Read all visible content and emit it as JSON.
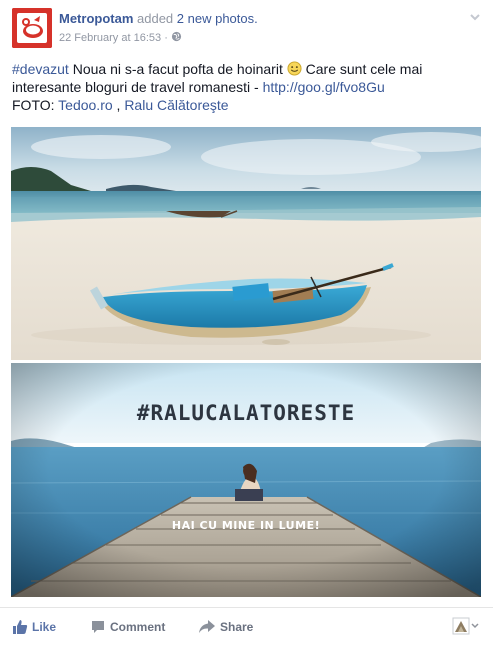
{
  "post": {
    "author": "Metropotam",
    "added_text": "added",
    "photos_link": "2 new photos.",
    "date": "22 February at 16:53",
    "meta_separator": "·",
    "hashtag": "#devazut",
    "text_main": " Noua ni s-a facut pofta de hoinarit ",
    "emoji": "smile-emoji",
    "text_cont": " Care sunt cele mai interesante bloguri de travel romanesti - ",
    "url": "http://goo.gl/fvo8Gu",
    "foto_label": "FOTO: ",
    "credit1": "Tedoo.ro",
    "credit_sep": " , ",
    "credit2": "Ralu Călătoreşte"
  },
  "photos": {
    "photo2_title": "#RALUCALATORESTE",
    "photo2_subtitle": "HAI CU MINE IN LUME!"
  },
  "actions": {
    "like": "Like",
    "comment": "Comment",
    "share": "Share"
  },
  "colors": {
    "brand_link": "#3b5998",
    "avatar_bg": "#d6322a"
  },
  "icons": {
    "avatar": "metropotam-logo",
    "globe": "globe-icon",
    "chevron": "chevron-down-icon",
    "like": "thumbs-up-icon",
    "comment": "comment-bubble-icon",
    "share": "share-arrow-icon",
    "switch": "page-avatar-icon"
  }
}
